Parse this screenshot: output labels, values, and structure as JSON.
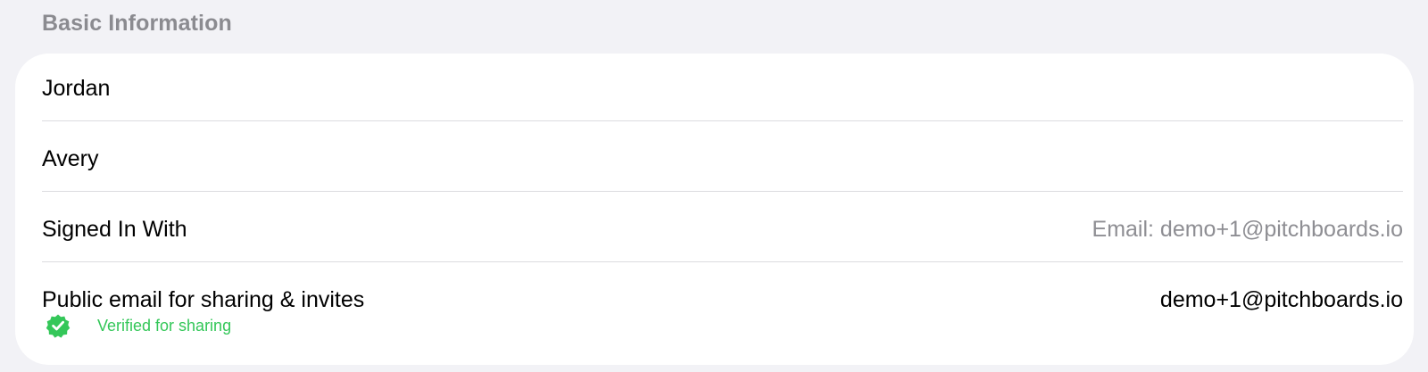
{
  "section": {
    "title": "Basic Information"
  },
  "rows": {
    "first_name": "Jordan",
    "last_name": "Avery",
    "signed_in": {
      "label": "Signed In With",
      "value": "Email: demo+1@pitchboards.io"
    },
    "public_email": {
      "label": "Public email for sharing & invites",
      "value": "demo+1@pitchboards.io",
      "status": "Verified for sharing"
    }
  },
  "colors": {
    "background": "#f2f2f6",
    "card": "#ffffff",
    "header_text": "#8b8b90",
    "muted_value": "#8e8e93",
    "verified_green": "#34c759"
  },
  "icons": {
    "verified": "verified-badge-icon"
  }
}
